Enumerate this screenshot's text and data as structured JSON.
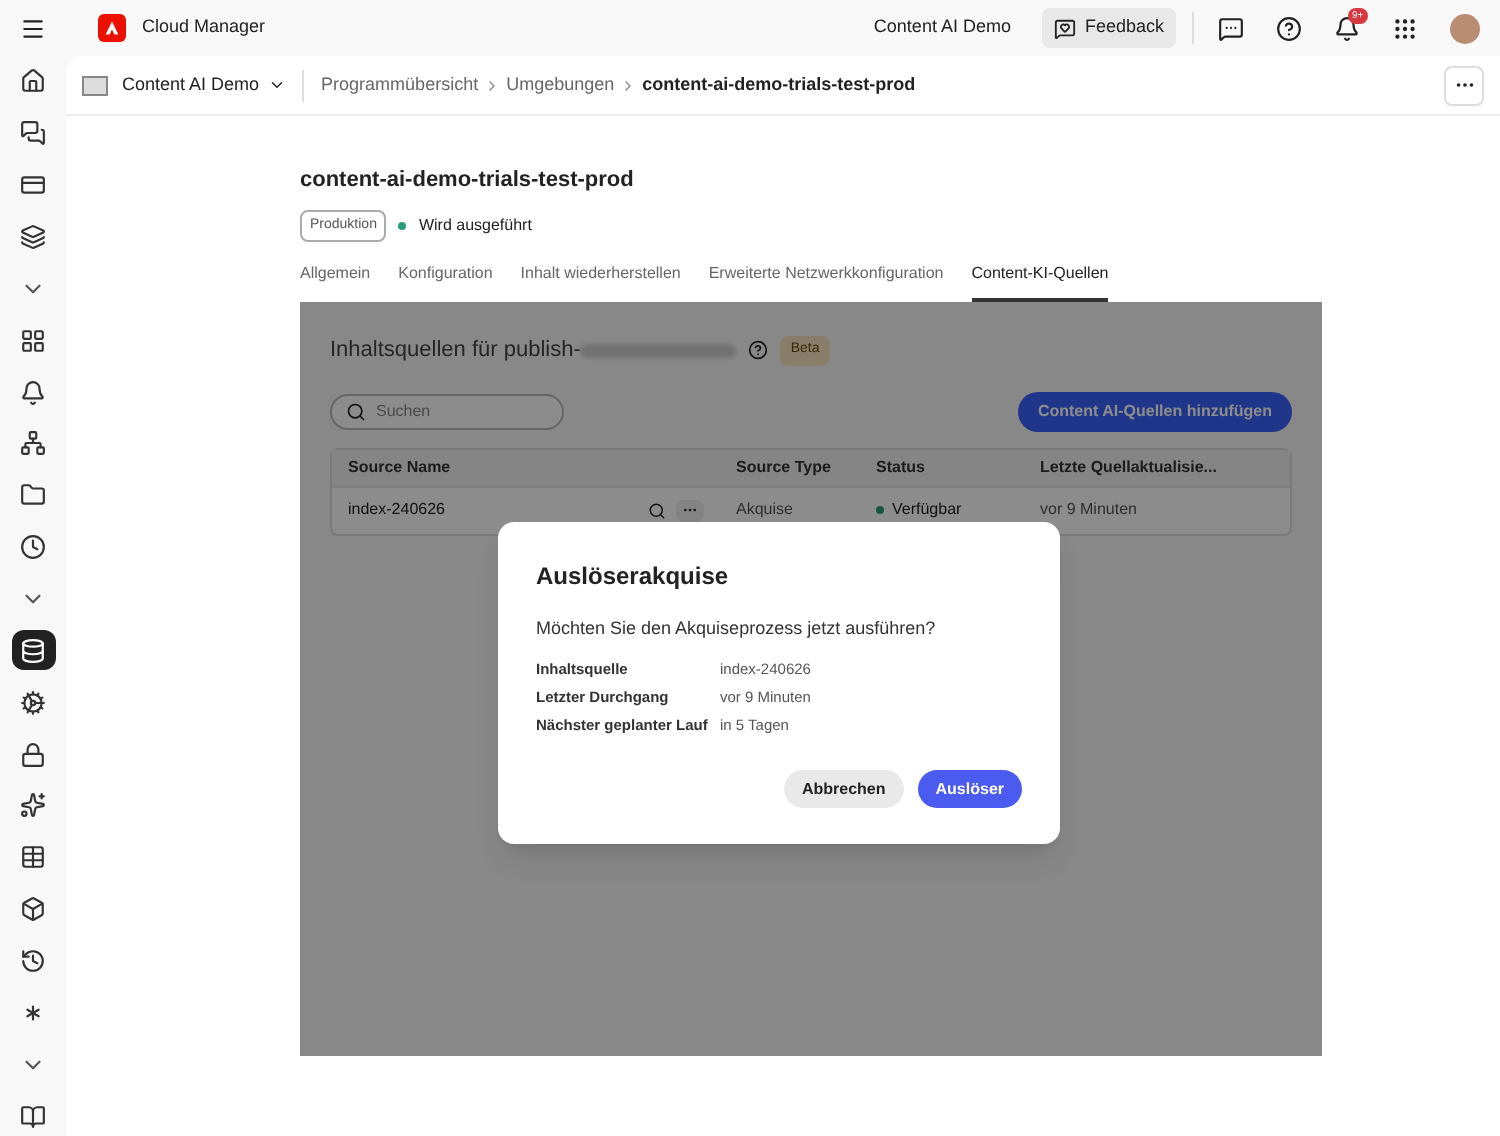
{
  "topbar": {
    "app_name": "Cloud Manager",
    "org": "Content AI Demo",
    "feedback": "Feedback",
    "notification_badge": "9+"
  },
  "sidebar": {
    "items": [
      {
        "kind": "icon",
        "selected": false
      },
      {
        "kind": "icon",
        "selected": false
      },
      {
        "kind": "icon",
        "selected": false
      },
      {
        "kind": "icon",
        "selected": false
      },
      {
        "kind": "toggle",
        "selected": false
      },
      {
        "kind": "icon",
        "selected": false
      },
      {
        "kind": "icon",
        "selected": false
      },
      {
        "kind": "icon",
        "selected": false
      },
      {
        "kind": "icon",
        "selected": false
      },
      {
        "kind": "icon",
        "selected": false
      },
      {
        "kind": "toggle",
        "selected": false
      },
      {
        "kind": "icon",
        "selected": true
      },
      {
        "kind": "icon",
        "selected": false
      },
      {
        "kind": "icon",
        "selected": false
      },
      {
        "kind": "icon",
        "selected": false
      },
      {
        "kind": "icon",
        "selected": false
      },
      {
        "kind": "icon",
        "selected": false
      },
      {
        "kind": "icon",
        "selected": false
      },
      {
        "kind": "icon",
        "selected": false
      },
      {
        "kind": "toggle",
        "selected": false
      },
      {
        "kind": "icon",
        "selected": false
      }
    ]
  },
  "breadcrumb": {
    "program": "Content AI Demo",
    "items": [
      "Programmübersicht",
      "Umgebungen",
      "content-ai-demo-trials-test-prod"
    ]
  },
  "environment": {
    "title": "content-ai-demo-trials-test-prod",
    "tag": "Produktion",
    "status": {
      "label": "Wird ausgeführt",
      "color": "#2d9d78"
    }
  },
  "tabs": [
    {
      "label": "Allgemein",
      "selected": false
    },
    {
      "label": "Konfiguration",
      "selected": false
    },
    {
      "label": "Inhalt wiederherstellen",
      "selected": false
    },
    {
      "label": "Erweiterte Netzwerkkonfiguration",
      "selected": false
    },
    {
      "label": "Content-KI-Quellen",
      "selected": true
    }
  ],
  "panel": {
    "heading": "Inhaltsquellen für publish-",
    "badge": "Beta",
    "search": {
      "placeholder": "Suchen"
    },
    "add_button": "Content AI-Quellen hinzufügen",
    "table": {
      "columns": [
        "Source Name",
        "Source Type",
        "Status",
        "Letzte Quellaktualisie..."
      ],
      "rows": [
        {
          "name": "index-240626",
          "type": "Akquise",
          "status": "Verfügbar",
          "color": "#195642",
          "updated": "vor 9 Minuten"
        }
      ]
    }
  },
  "dialog": {
    "title": "Auslöserakquise",
    "message": "Möchten Sie den Akquiseprozess jetzt ausführen?",
    "details": [
      {
        "label": "Inhaltsquelle",
        "value": "index-240626"
      },
      {
        "label": "Letzter Durchgang",
        "value": "vor 9 Minuten"
      },
      {
        "label": "Nächster geplanter Lauf",
        "value": "in 5 Tagen"
      }
    ],
    "buttons": [
      {
        "label": "Abbrechen",
        "kind": "secondary"
      },
      {
        "label": "Auslöser",
        "kind": "primary"
      }
    ]
  }
}
